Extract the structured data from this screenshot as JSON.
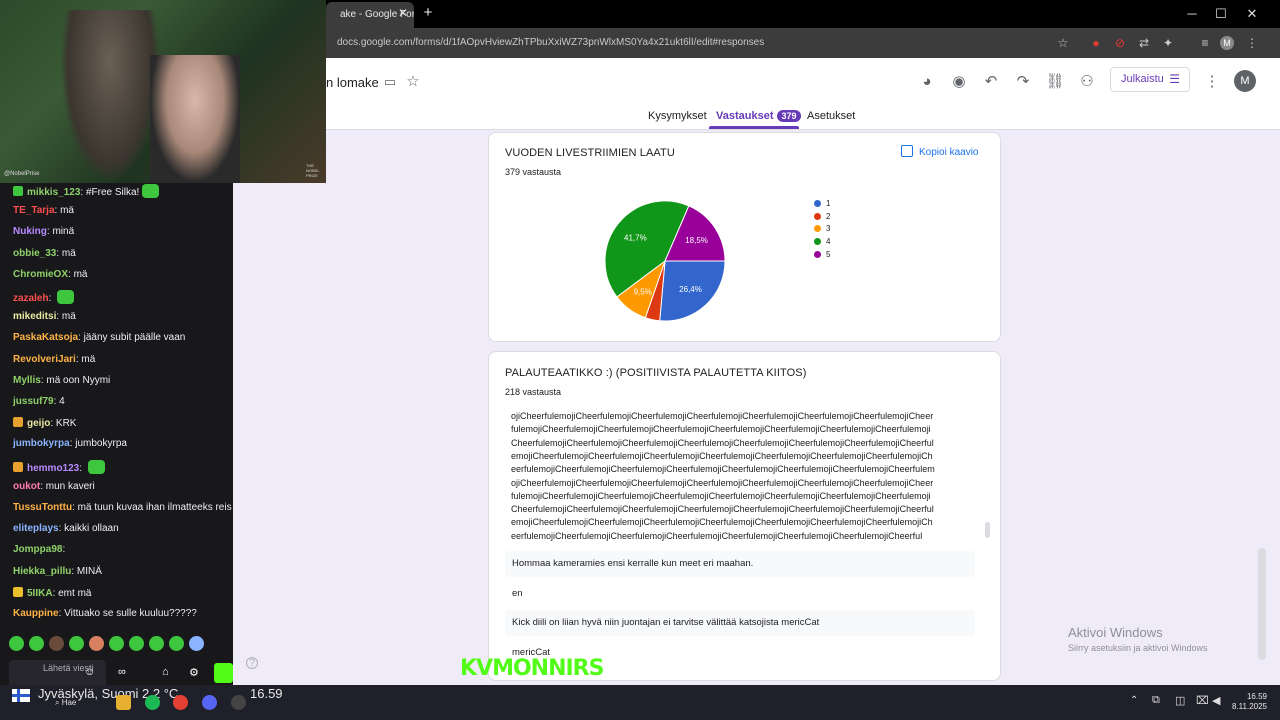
{
  "browser": {
    "tab_title": "ake - Google Forms",
    "url": "docs.google.com/forms/d/1fAOpvHviewZhTPbuXxiWZ73pnWlxMS0Ya4x21ukt6lI/edit#responses",
    "profile_initial": "M"
  },
  "form": {
    "title": "n lomake",
    "publish_label": "Julkaistu",
    "avatar_initial": "M",
    "tabs": [
      {
        "label": "Kysymykset"
      },
      {
        "label": "Vastaukset",
        "badge": "379"
      },
      {
        "label": "Asetukset"
      }
    ]
  },
  "question1": {
    "title": "VUODEN LIVESTRIIMIEN LAATU",
    "count": "379 vastausta",
    "copy_label": "Kopioi kaavio"
  },
  "chart_data": {
    "type": "pie",
    "title": "VUODEN LIVESTRIIMIEN LAATU",
    "categories": [
      "1",
      "2",
      "3",
      "4",
      "5"
    ],
    "values": [
      26.4,
      3.9,
      9.5,
      41.7,
      18.5
    ],
    "labels": [
      "26,4%",
      "",
      "9,5%",
      "41,7%",
      "18,5%"
    ],
    "colors": [
      "#3366cc",
      "#dc3912",
      "#ff9900",
      "#109618",
      "#990099"
    ],
    "legend_position": "right"
  },
  "question2": {
    "title": "PALAUTEAATIKKO :) (POSITIIVISTA PALAUTETTA KIITOS)",
    "count": "218 vastausta",
    "cheer_lines": [
      "ojiCheerfulemojiCheerfulemojiCheerfulemojiCheerfulemojiCheerfulemojiCheerfulemojiCheerfulemojiCheer",
      "fulemojiCheerfulemojiCheerfulemojiCheerfulemojiCheerfulemojiCheerfulemojiCheerfulemojiCheerfulemoji",
      "CheerfulemojiCheerfulemojiCheerfulemojiCheerfulemojiCheerfulemojiCheerfulemojiCheerfulemojiCheerful",
      "emojiCheerfulemojiCheerfulemojiCheerfulemojiCheerfulemojiCheerfulemojiCheerfulemojiCheerfulemojiCh",
      "eerfulemojiCheerfulemojiCheerfulemojiCheerfulemojiCheerfulemojiCheerfulemojiCheerfulemojiCheerfulem",
      "ojiCheerfulemojiCheerfulemojiCheerfulemojiCheerfulemojiCheerfulemojiCheerfulemojiCheerfulemojiCheer",
      "fulemojiCheerfulemojiCheerfulemojiCheerfulemojiCheerfulemojiCheerfulemojiCheerfulemojiCheerfulemoji",
      "CheerfulemojiCheerfulemojiCheerfulemojiCheerfulemojiCheerfulemojiCheerfulemojiCheerfulemojiCheerful",
      "emojiCheerfulemojiCheerfulemojiCheerfulemojiCheerfulemojiCheerfulemojiCheerfulemojiCheerfulemojiCh",
      "eerfulemojiCheerfulemojiCheerfulemojiCheerfulemojiCheerfulemojiCheerfulemojiCheerfulemojiCheerful"
    ],
    "responses": [
      "Hommaa kameramies ensi kerralle kun meet eri maahan.",
      "en",
      "Kick diili on liian hyvä niin juontajan ei tarvitse välittää katsojista mericCat",
      "mericCat"
    ]
  },
  "watermark": {
    "title": "Aktivoi Windows",
    "subtitle": "Siirry asetuksiin ja aktivoi Windows"
  },
  "webcam": {
    "handle": "@NobelPrise",
    "corner_text": "THE NOBEL PRIZE"
  },
  "chat": {
    "messages": [
      {
        "user": "mikkis_123",
        "color": "#8fd16a",
        "text": "#Free Silka!",
        "badge": "#3ec63e",
        "emote": true
      },
      {
        "user": "TE_Tarja",
        "color": "#ff4f4f",
        "text": "mä"
      },
      {
        "user": "Nuking",
        "color": "#b88aff",
        "text": "minä"
      },
      {
        "user": "obbie_33",
        "color": "#8fd16a",
        "text": "mä"
      },
      {
        "user": "ChromieOX",
        "color": "#8fd16a",
        "text": "mä"
      },
      {
        "user": "zazaleh",
        "color": "#ff4f4f",
        "text": "",
        "emote": true
      },
      {
        "user": "mikeditsi",
        "color": "#e8e8a0",
        "text": "mä"
      },
      {
        "user": "PaskaKatsoja",
        "color": "#ffb347",
        "text": "jääny subit päälle vaan"
      },
      {
        "user": "RevolveriJari",
        "color": "#ffb347",
        "text": "mä"
      },
      {
        "user": "Myllis",
        "color": "#8fd16a",
        "text": "mä oon Nyymi"
      },
      {
        "user": "jussuf79",
        "color": "#8fd16a",
        "text": "4"
      },
      {
        "user": "geijo",
        "color": "#e8e8a0",
        "text": "KRK",
        "badge": "#e8a030"
      },
      {
        "user": "jumbokyrpa",
        "color": "#8ab4ff",
        "text": "jumbokyrpa"
      },
      {
        "user": "hemmo123",
        "color": "#b88aff",
        "text": "",
        "badge": "#e8a030",
        "emote": true
      },
      {
        "user": "oukot",
        "color": "#ff7ab0",
        "text": "mun kaveri"
      },
      {
        "user": "TussuTonttu",
        "color": "#ffb347",
        "text": "mä tuun kuvaa ihan ilmatteeks reis"
      },
      {
        "user": "eliteplays",
        "color": "#8ab4ff",
        "text": "kaikki ollaan"
      },
      {
        "user": "Jomppa98",
        "color": "#8fd16a",
        "text": ""
      },
      {
        "user": "Hiekka_pillu",
        "color": "#8fd16a",
        "text": "MINÄ"
      },
      {
        "user": "5IIKA",
        "color": "#8fd16a",
        "text": "emt mä",
        "badge": "#e8c030"
      },
      {
        "user": "Kauppine",
        "color": "#ffb347",
        "text": "Vittuako se sulle kuuluu?????"
      }
    ],
    "send_placeholder": "Lähetä viesti"
  },
  "taskbar": {
    "weather": "Jyväskylä, Suomi  2,2 °C",
    "stream_time": "16.59",
    "search_label": "Hae",
    "time": "16.59",
    "date": "8.11.2025"
  },
  "overlay_logo": "KVMONNIRS"
}
